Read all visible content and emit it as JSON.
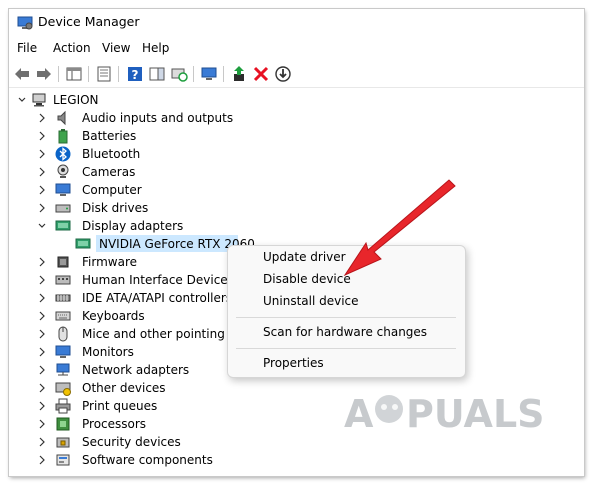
{
  "window": {
    "title": "Device Manager"
  },
  "menu": {
    "items": [
      "File",
      "Action",
      "View",
      "Help"
    ]
  },
  "tree": {
    "root": "LEGION",
    "items": [
      "Audio inputs and outputs",
      "Batteries",
      "Bluetooth",
      "Cameras",
      "Computer",
      "Disk drives",
      "Display adapters",
      "NVIDIA GeForce RTX 2060",
      "Firmware",
      "Human Interface Devices",
      "IDE ATA/ATAPI controllers",
      "Keyboards",
      "Mice and other pointing devices",
      "Monitors",
      "Network adapters",
      "Other devices",
      "Print queues",
      "Processors",
      "Security devices",
      "Software components"
    ]
  },
  "context_menu": {
    "update": "Update driver",
    "disable": "Disable device",
    "uninstall": "Uninstall device",
    "scan": "Scan for hardware changes",
    "properties": "Properties"
  },
  "watermark": {
    "text": "A PUALS"
  },
  "colors": {
    "accent": "#0078d4",
    "selection": "#cce8ff",
    "arrow": "#e8262b",
    "delete": "#e81123",
    "green": "#1e9e3e"
  }
}
